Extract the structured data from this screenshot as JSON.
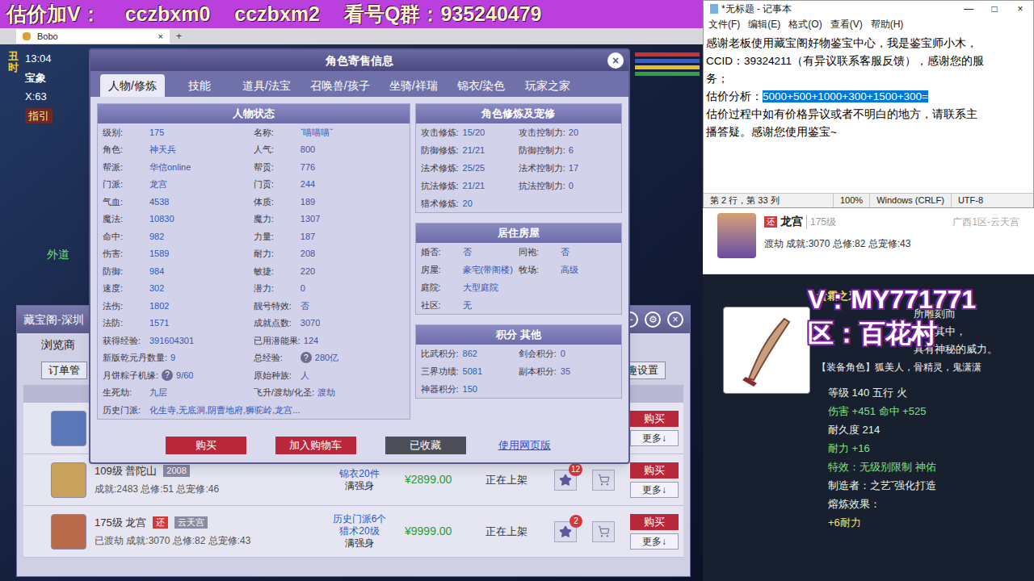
{
  "banner": {
    "segments": [
      "估价加V：",
      "cczbxm0",
      "cczbxm2",
      "看号Q群：935240479"
    ]
  },
  "game": {
    "browser_tab": {
      "title": "Bobo",
      "close": "×",
      "new": "+"
    },
    "hud": {
      "time": "13:04",
      "map": "宝象",
      "coords": "X:63",
      "guide": "指引",
      "period": "丑时",
      "npc": "外道"
    }
  },
  "dialog": {
    "title": "角色寄售信息",
    "close": "×",
    "help_icon": "?",
    "tabs": [
      {
        "label": "人物/修炼",
        "selected": true
      },
      {
        "label": "技能",
        "selected": false
      },
      {
        "label": "道具/法宝",
        "selected": false
      },
      {
        "label": "召唤兽/孩子",
        "selected": false
      },
      {
        "label": "坐骑/祥瑞",
        "selected": false
      },
      {
        "label": "锦衣/染色",
        "selected": false
      },
      {
        "label": "玩家之家",
        "selected": false
      }
    ],
    "status_panel": {
      "title": "人物状态",
      "rows": [
        [
          {
            "label": "级别:",
            "value": "175",
            "help": false
          },
          {
            "label": "名称:",
            "value": "ˇ喵喵喵ˇ",
            "help": false
          }
        ],
        [
          {
            "label": "角色:",
            "value": "神天兵",
            "help": false
          },
          {
            "label": "人气:",
            "value": "800",
            "help": false
          }
        ],
        [
          {
            "label": "帮派:",
            "value": "华信online",
            "help": false
          },
          {
            "label": "帮贡:",
            "value": "776",
            "help": false
          }
        ],
        [
          {
            "label": "门派:",
            "value": "龙宫",
            "help": false
          },
          {
            "label": "门贡:",
            "value": "244",
            "help": false
          }
        ],
        [
          {
            "label": "气血:",
            "value": "4538",
            "help": false
          },
          {
            "label": "体质:",
            "value": "189",
            "help": false
          }
        ],
        [
          {
            "label": "魔法:",
            "value": "10830",
            "help": false
          },
          {
            "label": "魔力:",
            "value": "1307",
            "help": false
          }
        ],
        [
          {
            "label": "命中:",
            "value": "982",
            "help": false
          },
          {
            "label": "力量:",
            "value": "187",
            "help": false
          }
        ],
        [
          {
            "label": "伤害:",
            "value": "1589",
            "help": false
          },
          {
            "label": "耐力:",
            "value": "208",
            "help": false
          }
        ],
        [
          {
            "label": "防御:",
            "value": "984",
            "help": false
          },
          {
            "label": "敏捷:",
            "value": "220",
            "help": false
          }
        ],
        [
          {
            "label": "速度:",
            "value": "302",
            "help": false
          },
          {
            "label": "潜力:",
            "value": "0",
            "help": false
          }
        ],
        [
          {
            "label": "法伤:",
            "value": "1802",
            "help": false
          },
          {
            "label": "靓号特效:",
            "value": "否",
            "help": false
          }
        ],
        [
          {
            "label": "法防:",
            "value": "1571",
            "help": false
          },
          {
            "label": "成就点数:",
            "value": "3070",
            "help": false
          }
        ],
        [
          {
            "label": "获得经验:",
            "value": "391604301",
            "help": false
          },
          {
            "label": "已用潜能果:",
            "value": "124",
            "help": false
          }
        ],
        [
          {
            "label": "新版乾元丹数量:",
            "value": "9",
            "help": false
          },
          {
            "label": "总经验:",
            "value": "280亿",
            "help": true
          }
        ],
        [
          {
            "label": "月饼粽子机缘:",
            "value": "9/60",
            "help": true
          },
          {
            "label": "原始种族:",
            "value": "人",
            "help": false
          }
        ],
        [
          {
            "label": "生死劫:",
            "value": "九层",
            "help": false
          },
          {
            "label": "飞升/渡劫/化圣:",
            "value": "渡劫",
            "help": false
          }
        ],
        [
          {
            "label": "历史门派:",
            "value": "化生寺,无底洞,阴曹地府,狮驼岭,龙宫...",
            "help": false
          }
        ]
      ]
    },
    "right_sections": [
      {
        "title": "角色修炼及宠修",
        "rows": [
          [
            {
              "label": "攻击修炼:",
              "value": "15/20",
              "help": false
            },
            {
              "label": "攻击控制力:",
              "value": "20",
              "help": false
            }
          ],
          [
            {
              "label": "防御修炼:",
              "value": "21/21",
              "help": false
            },
            {
              "label": "防御控制力:",
              "value": "6",
              "help": false
            }
          ],
          [
            {
              "label": "法术修炼:",
              "value": "25/25",
              "help": false
            },
            {
              "label": "法术控制力:",
              "value": "17",
              "help": false
            }
          ],
          [
            {
              "label": "抗法修炼:",
              "value": "21/21",
              "help": false
            },
            {
              "label": "抗法控制力:",
              "value": "0",
              "help": false
            }
          ],
          [
            {
              "label": "猎术修炼:",
              "value": "20",
              "help": false
            }
          ]
        ]
      },
      {
        "title": "居住房屋",
        "rows": [
          [
            {
              "label": "婚否:",
              "value": "否",
              "help": false
            },
            {
              "label": "同袍:",
              "value": "否",
              "help": false
            }
          ],
          [
            {
              "label": "房屋:",
              "value": "豪宅(带阁楼)",
              "help": false
            },
            {
              "label": "牧场:",
              "value": "高级",
              "help": false
            }
          ],
          [
            {
              "label": "庭院:",
              "value": "大型庭院",
              "help": false
            }
          ],
          [
            {
              "label": "社区:",
              "value": "无",
              "help": false
            }
          ]
        ]
      },
      {
        "title": "积分 其他",
        "rows": [
          [
            {
              "label": "比武积分:",
              "value": "862",
              "help": false
            },
            {
              "label": "剑会积分:",
              "value": "0",
              "help": false
            }
          ],
          [
            {
              "label": "三界功绩:",
              "value": "5081",
              "help": false
            },
            {
              "label": "副本积分:",
              "value": "35",
              "help": false
            }
          ],
          [
            {
              "label": "神器积分:",
              "value": "150",
              "help": false
            }
          ]
        ]
      }
    ],
    "buttons": [
      {
        "label": "购买",
        "kind": "primary"
      },
      {
        "label": "加入购物车",
        "kind": "primary"
      },
      {
        "label": "已收藏",
        "kind": "muted"
      },
      {
        "label": "使用网页版",
        "kind": "link"
      }
    ]
  },
  "list_window": {
    "title": "藏宝阁-深圳",
    "controls": [
      "−",
      "⚙",
      "×"
    ],
    "browse": "浏览商",
    "orders": "订单管",
    "interest": "兴趣设置",
    "rows": [
      {
        "kind": "covered",
        "avatar_color": "#5a78b8",
        "buy": "购买",
        "more": "更多↓"
      },
      {
        "kind": "full",
        "avatar_color": "#c8a25a",
        "title": "109级 普陀山",
        "tags": [
          {
            "text": "2008",
            "color": "#8a8aa0"
          }
        ],
        "stats": "成就:2483 总修:51 总宠修:46",
        "desc": [
          {
            "text": "锦衣20件",
            "color": "#2a56c6"
          },
          {
            "text": "满强身",
            "color": "#222222"
          }
        ],
        "price": "¥2899.00",
        "status": "正在上架",
        "favorites": "12",
        "buy": "购买",
        "more": "更多↓"
      },
      {
        "kind": "full",
        "avatar_color": "#b86a4a",
        "title": "175级 龙宫",
        "tags": [
          {
            "text": "还",
            "color": "#d23a3a"
          },
          {
            "text": "云天宫",
            "color": "#8a8aa0"
          }
        ],
        "stats": "已渡劫 成就:3070 总修:82 总宠修:43",
        "desc": [
          {
            "text": "历史门派6个",
            "color": "#2a56c6"
          },
          {
            "text": "猎术20级",
            "color": "#2a56c6"
          },
          {
            "text": "满强身",
            "color": "#222222"
          }
        ],
        "price": "¥9999.00",
        "status": "正在上架",
        "favorites": "2",
        "buy": "购买",
        "more": "更多↓"
      }
    ]
  },
  "notepad": {
    "title": "*无标题 - 记事本",
    "controls": [
      "—",
      "□",
      "×"
    ],
    "menu": [
      "文件(F)",
      "编辑(E)",
      "格式(O)",
      "查看(V)",
      "帮助(H)"
    ],
    "lines": [
      [
        {
          "text": "感谢老板使用藏宝阁好物鉴宝中心，我是鉴宝师小木，",
          "selected": false
        }
      ],
      [
        {
          "text": "CCID：39324211（有异议联系客服反馈），感谢您的服",
          "selected": false
        }
      ],
      [
        {
          "text": "务；",
          "selected": false
        }
      ],
      [
        {
          "text": "估价分析：",
          "selected": false
        },
        {
          "text": "5000+500+1000+300+1500+300=",
          "selected": true
        }
      ],
      [
        {
          "text": "估价过程中如有价格异议或者不明白的地方，请联系主",
          "selected": false
        }
      ],
      [
        {
          "text": "播答疑。感谢您使用鉴宝~",
          "selected": false
        }
      ]
    ],
    "status": [
      "第 2 行，第 33 列",
      "100%",
      "Windows (CRLF)",
      "UTF-8"
    ]
  },
  "seller_card": {
    "badge": "还",
    "school": "龙宫",
    "level": "175级",
    "server": "广西1区-云天宫",
    "stats": "渡劫 成就:3070 总修:82 总宠修:43"
  },
  "item_panel": {
    "overlay": [
      "V：MY771771",
      "区：百花村"
    ],
    "name": "贵霜之牙",
    "desc": [
      "所雕刻而",
      "贯注其中，",
      "具有神秘的威力。"
    ],
    "roles": "【装备角色】狐美人，骨精灵，鬼潇潇",
    "stats": [
      {
        "text": "等级 140 五行 火",
        "color": "#e8f4e0"
      },
      {
        "text": "伤害 +451 命中 +525",
        "color": "#7fe07a"
      },
      {
        "text": "耐久度 214",
        "color": "#e8f4e0"
      },
      {
        "text": "耐力 +16",
        "color": "#7fe07a"
      },
      {
        "text": "特效：无级别限制 神佑",
        "color": "#7fe07a"
      },
      {
        "text": "制造者：之艺ˇ强化打造",
        "color": "#e8f4e0"
      },
      {
        "text": "熔炼效果：",
        "color": "#e8f4e0"
      },
      {
        "text": "+6耐力",
        "color": "#f0e070"
      }
    ]
  }
}
